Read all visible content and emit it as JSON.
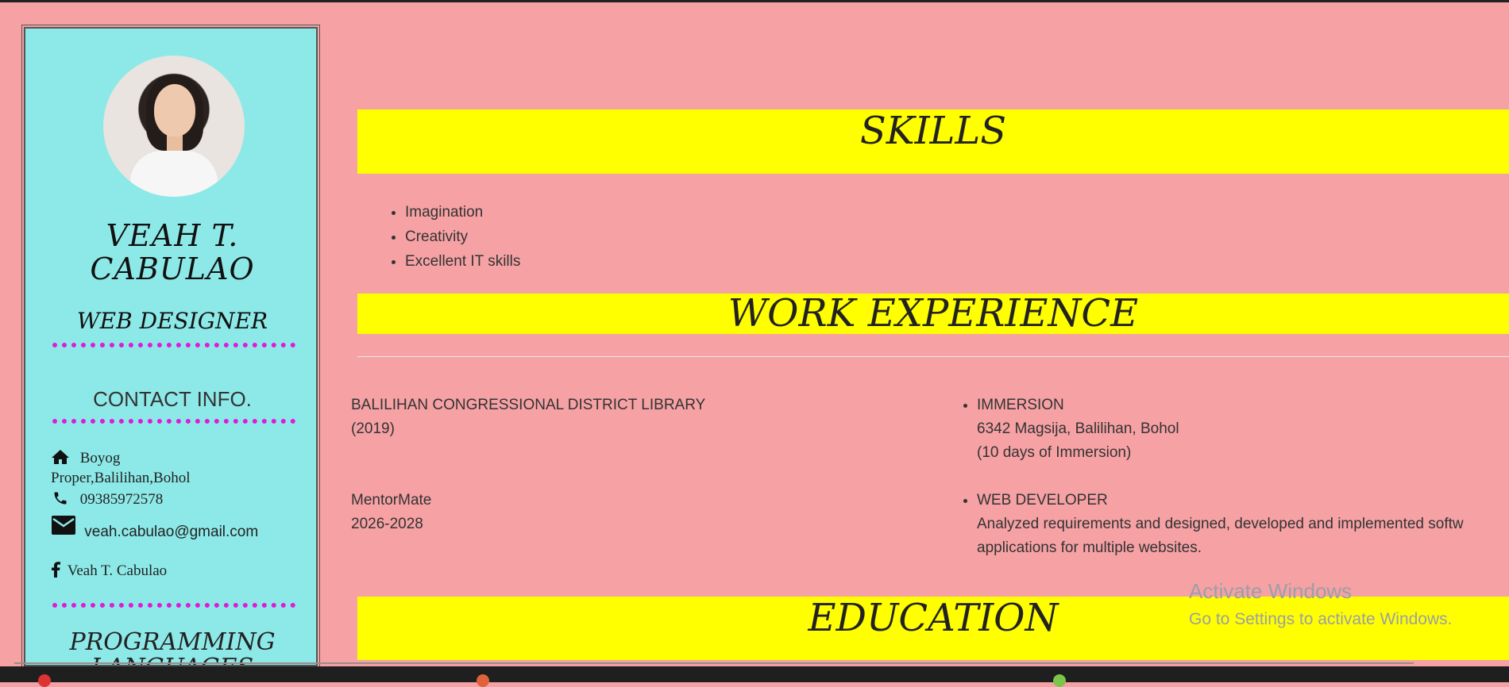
{
  "sidebar": {
    "name_line1": "VEAH T.",
    "name_line2": "CABULAO",
    "role": "WEB DESIGNER",
    "contact_title": "CONTACT INFO.",
    "address_line1": "Boyog",
    "address_line2": "Proper,Balilihan,Bohol",
    "phone": "09385972578",
    "email": "veah.cabulao@gmail.com",
    "facebook": "Veah T. Cabulao",
    "programming_title_line1": "PROGRAMMING",
    "programming_title_line2": "LANGUAGES"
  },
  "skills": {
    "title": "SKILLS",
    "items": [
      "Imagination",
      "Creativity",
      "Excellent IT skills"
    ]
  },
  "work_experience": {
    "title": "WORK EXPERIENCE",
    "entries": [
      {
        "org": "BALILIHAN CONGRESSIONAL DISTRICT LIBRARY",
        "period": "(2019)",
        "role": "IMMERSION",
        "details": [
          "6342 Magsija, Balilihan, Bohol",
          "(10 days of Immersion)"
        ]
      },
      {
        "org": "MentorMate",
        "period": "2026-2028",
        "role": "WEB DEVELOPER",
        "details": [
          "Analyzed requirements and designed, developed and implemented softw",
          "applications for multiple websites."
        ]
      }
    ]
  },
  "education": {
    "title": "EDUCATION"
  },
  "watermark": {
    "title": "Activate Windows",
    "subtitle": "Go to Settings to activate Windows."
  },
  "colors": {
    "page_bg": "#f6a1a4",
    "sidebar_bg": "#8de9e8",
    "banner": "#ffff00",
    "dots": "#e01ad8"
  },
  "icons": [
    "home-icon",
    "phone-icon",
    "mail-icon",
    "facebook-icon"
  ]
}
